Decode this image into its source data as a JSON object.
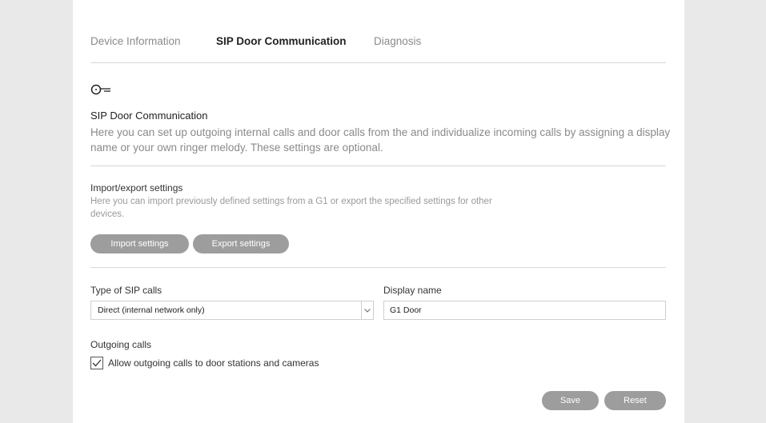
{
  "tabs": [
    {
      "label": "Device Information"
    },
    {
      "label": "SIP Door Communication"
    },
    {
      "label": "Diagnosis"
    }
  ],
  "icon": "key-icon",
  "section": {
    "title": "SIP Door Communication",
    "description": "Here you can set up outgoing internal calls and door calls from the and individualize incoming calls by assigning a display name or your own ringer melody. These settings are optional."
  },
  "import_export": {
    "title": "Import/export settings",
    "description": "Here you can import previously defined settings from a G1 or export the specified settings for other devices.",
    "import_label": "Import settings",
    "export_label": "Export settings"
  },
  "sip_calls": {
    "label": "Type of SIP calls",
    "selected": "Direct (internal network only)"
  },
  "display_name": {
    "label": "Display name",
    "value": "G1 Door"
  },
  "outgoing": {
    "label": "Outgoing calls",
    "checkbox_label": "Allow outgoing calls to door stations and cameras",
    "checked": true
  },
  "actions": {
    "save_label": "Save",
    "reset_label": "Reset"
  },
  "colors": {
    "button_gray": "#9d9d9d",
    "background": "#e9e9e9"
  }
}
